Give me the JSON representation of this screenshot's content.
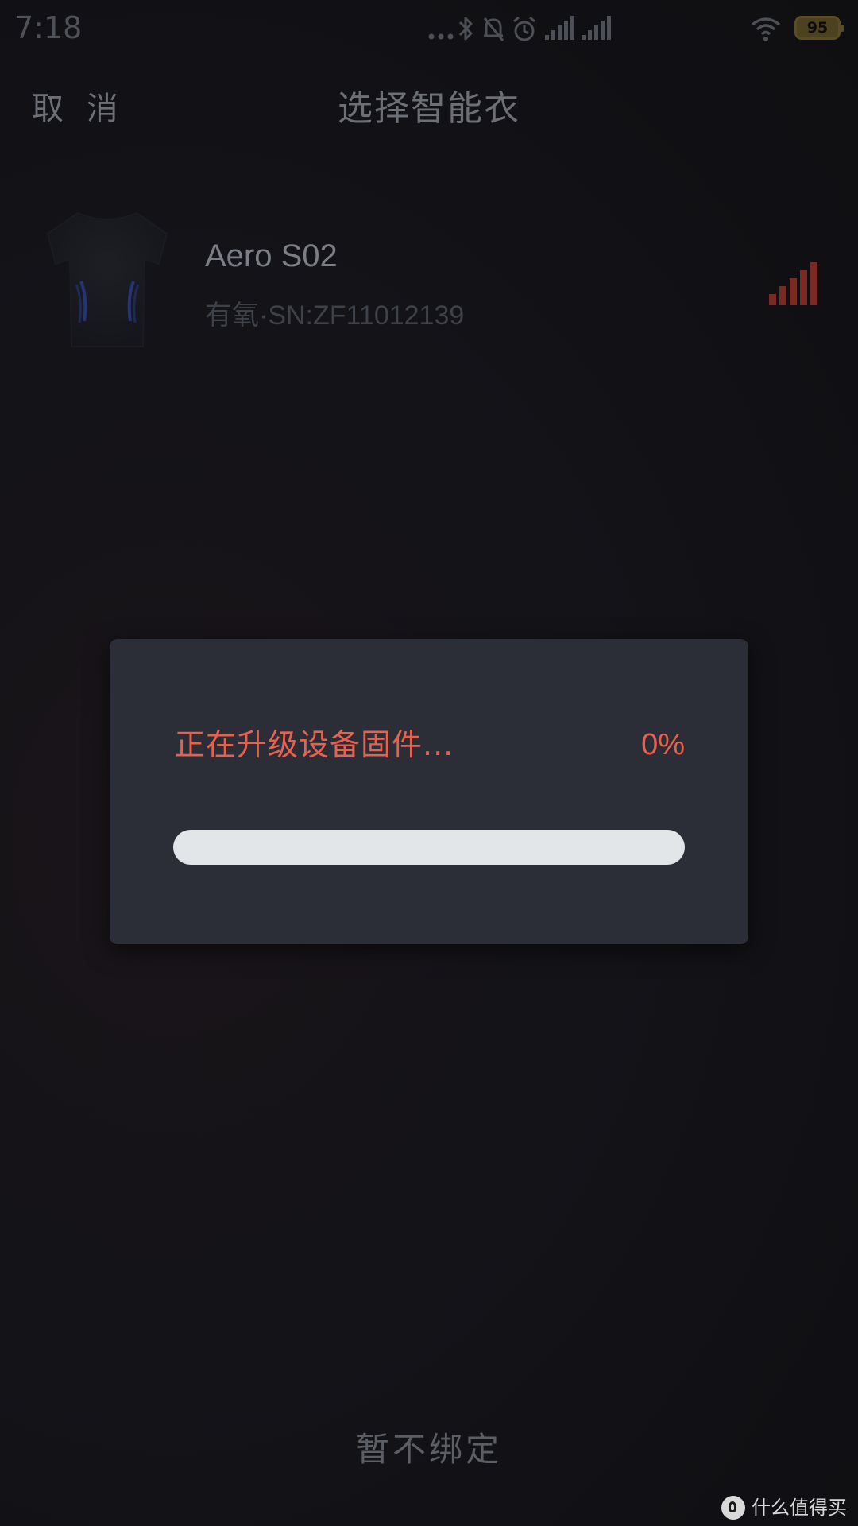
{
  "status_bar": {
    "time": "7:18",
    "battery_level": "95",
    "icons": [
      "more-dots-icon",
      "bluetooth-icon",
      "mute-bell-icon",
      "alarm-icon",
      "cell-signal-icon",
      "cell-signal-icon",
      "wifi-icon",
      "battery-icon"
    ]
  },
  "header": {
    "cancel_label": "取 消",
    "title": "选择智能衣"
  },
  "device": {
    "name": "Aero S02",
    "subtitle": "有氧·SN:ZF11012139",
    "image": "shirt-image",
    "signal_icon": "signal-strength-icon"
  },
  "dialog": {
    "message": "正在升级设备固件...",
    "percent_label": "0%",
    "progress": 0
  },
  "footer": {
    "skip_label": "暂不绑定"
  },
  "watermark": {
    "text": "什么值得买"
  },
  "colors": {
    "accent": "#e9604c",
    "background": "#121317",
    "dialog_background": "#2b2e36",
    "progress_track": "#e3e6e8",
    "signal": "#7a2a22"
  }
}
